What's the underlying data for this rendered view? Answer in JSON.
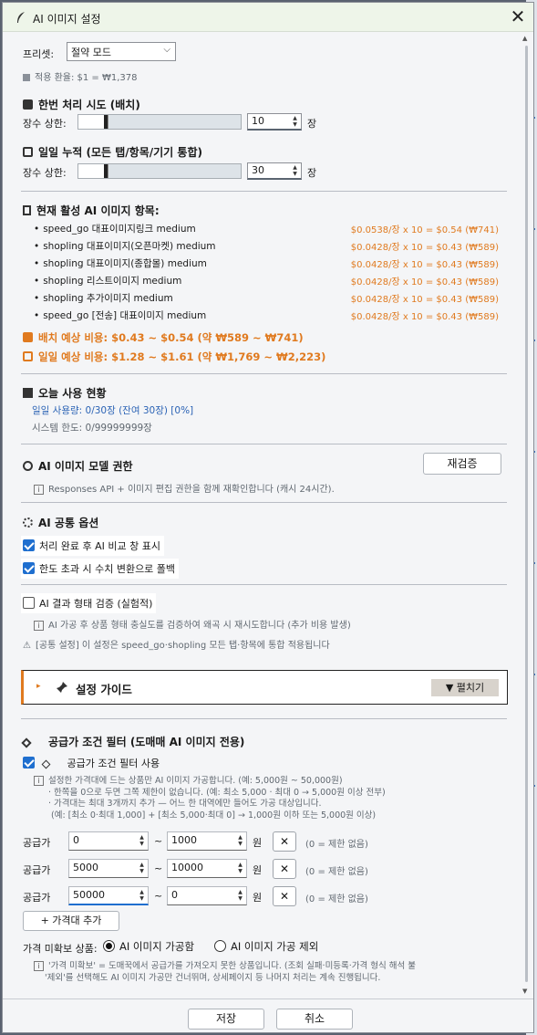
{
  "window": {
    "title": "AI 이미지 설정",
    "close": "✕"
  },
  "preset": {
    "label": "프리셋:",
    "value": "절약 모드",
    "rate": "적용 환율: $1 = ₩1,378"
  },
  "batch": {
    "title": "한번 처리 시도 (배치)",
    "label": "장수 상한:",
    "value": "10",
    "unit": "장",
    "slider_fraction": 0.18
  },
  "daily": {
    "title": "일일 누적 (모든 탭/항목/기기 통합)",
    "label": "장수 상한:",
    "value": "30",
    "unit": "장",
    "slider_fraction": 0.18
  },
  "active": {
    "title": "현재 활성 AI 이미지 항목:",
    "items": [
      {
        "name": "speed_go 대표이미지링크  medium",
        "cost": "$0.0538/장 x 10 = $0.54 (₩741)"
      },
      {
        "name": "shopling 대표이미지(오픈마켓)  medium",
        "cost": "$0.0428/장 x 10 = $0.43 (₩589)"
      },
      {
        "name": "shopling 대표이미지(종합몰)  medium",
        "cost": "$0.0428/장 x 10 = $0.43 (₩589)"
      },
      {
        "name": "shopling 리스트이미지  medium",
        "cost": "$0.0428/장 x 10 = $0.43 (₩589)"
      },
      {
        "name": "shopling 추가이미지  medium",
        "cost": "$0.0428/장 x 10 = $0.43 (₩589)"
      },
      {
        "name": "speed_go [전송] 대표이미지  medium",
        "cost": "$0.0428/장 x 10 = $0.43 (₩589)"
      }
    ],
    "batch_cost": "배치 예상 비용: $0.43 ~ $0.54 (약 ₩589 ~ ₩741)",
    "daily_cost": "일일 예상 비용: $1.28 ~ $1.61 (약 ₩1,769 ~ ₩2,223)"
  },
  "usage": {
    "title": "오늘 사용 현황",
    "daily": "일일 사용량: 0/30장 (잔여 30장) [0%]",
    "system": "시스템 한도: 0/99999999장"
  },
  "model": {
    "title": "AI 이미지 모델 권한",
    "recheck": "재검증",
    "info": "Responses API + 이미지 편집 권한을 함께 재확인합니다 (캐시 24시간)."
  },
  "common": {
    "title": "AI 공통 옵션",
    "opt1": "처리 완료 후 AI 비교 창 표시",
    "opt2": "한도 초과 시 수치 변환으로 폴백"
  },
  "verify": {
    "label": "AI 결과 형태 검증 (실험적)",
    "info": "AI 가공 후 상품 형태 충실도를 검증하여 왜곡 시 재시도합니다 (추가 비용 발생)",
    "note": "[공통 설정] 이 설정은 speed_go·shopling 모든 탭·항목에 통합 적용됩니다"
  },
  "guide": {
    "title": "설정 가이드",
    "expand": "▼ 펼치기"
  },
  "price_filter": {
    "title": "공급가 조건 필터 (도매매 AI 이미지 전용)",
    "use_label": "공급가 조건 필터 사용",
    "desc": [
      "설정한 가격대에 드는 상품만 AI 이미지 가공합니다. (예: 5,000원 ~ 50,000원)",
      "· 한쪽을 0으로 두면 그쪽 제한이 없습니다. (예: 최소 5,000 · 최대 0 → 5,000원 이상 전부)",
      "· 가격대는 최대 3개까지 추가 — 어느 한 대역에만 들어도 가공 대상입니다.",
      "(예: [최소 0·최대 1,000] + [최소 5,000·최대 0] → 1,000원 이하 또는 5,000원 이상)"
    ],
    "row_label": "공급가",
    "tilde": "~",
    "won": "원",
    "x_label": "✕",
    "hint": "(0 = 제한 없음)",
    "rows": [
      {
        "min": "0",
        "max": "1000"
      },
      {
        "min": "5000",
        "max": "10000"
      },
      {
        "min": "50000",
        "max": "0"
      }
    ],
    "add": "+ 가격대 추가"
  },
  "unverified": {
    "label": "가격 미확보 상품:",
    "opt1": "AI 이미지 가공함",
    "opt2": "AI 이미지 가공 제외",
    "info1": "'가격 미확보' = 도매꾹에서 공급가를 가져오지 못한 상품입니다. (조회 실패·미등록·가격 형식 해석 불",
    "info2": "'제외'를 선택해도 AI 이미지 가공만 건너뛰며, 상세페이지 등 나머지 처리는 계속 진행됩니다."
  },
  "footer": {
    "save": "저장",
    "cancel": "취소"
  }
}
